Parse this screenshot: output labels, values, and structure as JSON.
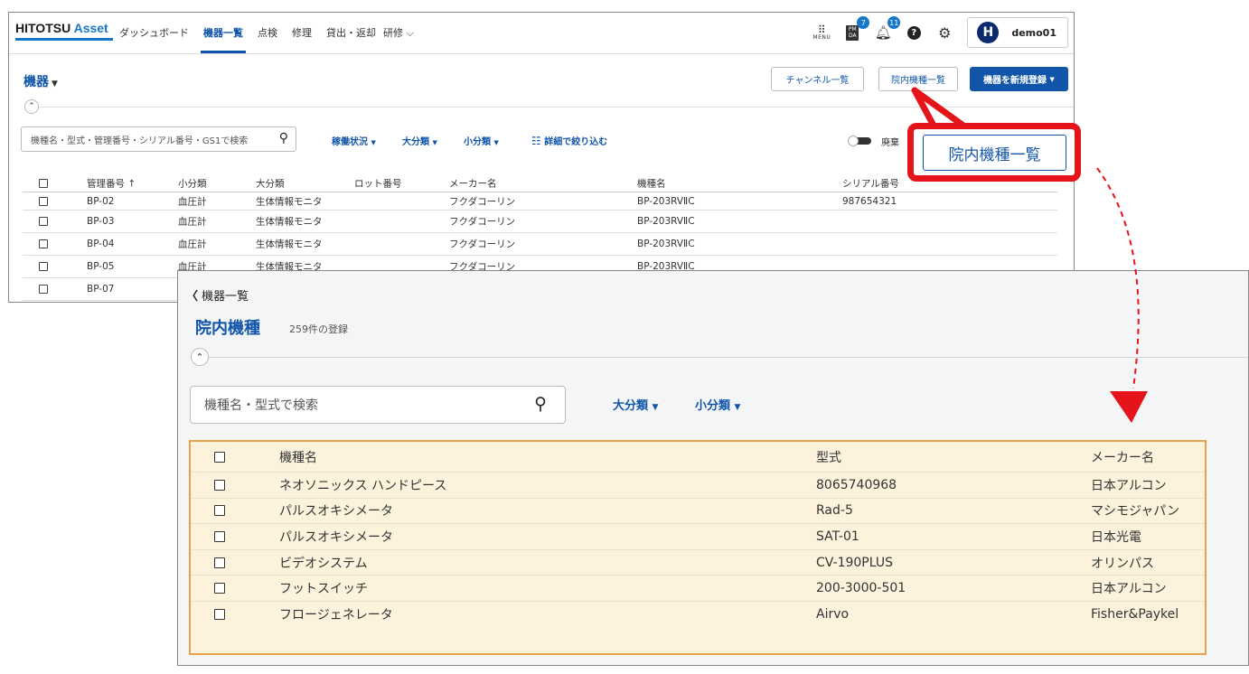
{
  "nav": {
    "logo_main": "HITOTSU",
    "logo_accent": "Asset",
    "links": [
      "ダッシュボード",
      "機器一覧",
      "点検",
      "修理",
      "貸出・返却",
      "研修"
    ],
    "menu_label": "MENU",
    "pmda_label_top": "PM",
    "pmda_label_bottom": "DA",
    "pmda_badge": "7",
    "bell_badge": "11",
    "avatar_letter": "H",
    "user_name": "demo01"
  },
  "devices_page": {
    "title": "機器",
    "buttons": {
      "channel_list": "チャンネル一覧",
      "model_list": "院内機種一覧",
      "register": "機器を新規登録"
    },
    "search_placeholder": "機種名・型式・管理番号・シリアル番号・GS1で検索",
    "filters": [
      "稼働状況",
      "大分類",
      "小分類"
    ],
    "detail_filter": "詳細で絞り込む",
    "toggle_label": "廃棄",
    "columns": [
      "管理番号 ↑",
      "小分類",
      "大分類",
      "ロット番号",
      "メーカー名",
      "機種名",
      "シリアル番号"
    ],
    "rows": [
      [
        "BP-02",
        "血圧計",
        "生体情報モニタ",
        "",
        "フクダコーリン",
        "BP-203RVⅡC",
        "987654321"
      ],
      [
        "BP-03",
        "血圧計",
        "生体情報モニタ",
        "",
        "フクダコーリン",
        "BP-203RVⅡC",
        ""
      ],
      [
        "BP-04",
        "血圧計",
        "生体情報モニタ",
        "",
        "フクダコーリン",
        "BP-203RVⅡC",
        ""
      ],
      [
        "BP-05",
        "血圧計",
        "生体情報モニタ",
        "",
        "フクダコーリン",
        "BP-203RVⅡC",
        ""
      ],
      [
        "BP-07",
        "",
        "",
        "",
        "",
        "",
        ""
      ]
    ]
  },
  "model_page": {
    "back_label": "機器一覧",
    "title": "院内機種",
    "count": "259件の登録",
    "search_placeholder": "機種名・型式で検索",
    "filters": [
      "大分類",
      "小分類"
    ],
    "columns": [
      "機種名",
      "型式",
      "メーカー名"
    ],
    "rows": [
      [
        "ネオソニックス ハンドピース",
        "8065740968",
        "日本アルコン"
      ],
      [
        "パルスオキシメータ",
        "Rad-5",
        "マシモジャパン"
      ],
      [
        "パルスオキシメータ",
        "SAT-01",
        "日本光電"
      ],
      [
        "ビデオシステム",
        "CV-190PLUS",
        "オリンパス"
      ],
      [
        "フットスイッチ",
        "200-3000-501",
        "日本アルコン"
      ],
      [
        "フロージェネレータ",
        "Airvo",
        "Fisher&Paykel"
      ]
    ]
  },
  "callout": {
    "label": "院内機種一覧",
    "highlight_color": "#e5141b",
    "arrow_color": "#e5141b"
  },
  "colors": {
    "brand": "#1155aa",
    "table_highlight_border": "#e8a04a",
    "table_highlight_fill": "#fdf3dc"
  }
}
